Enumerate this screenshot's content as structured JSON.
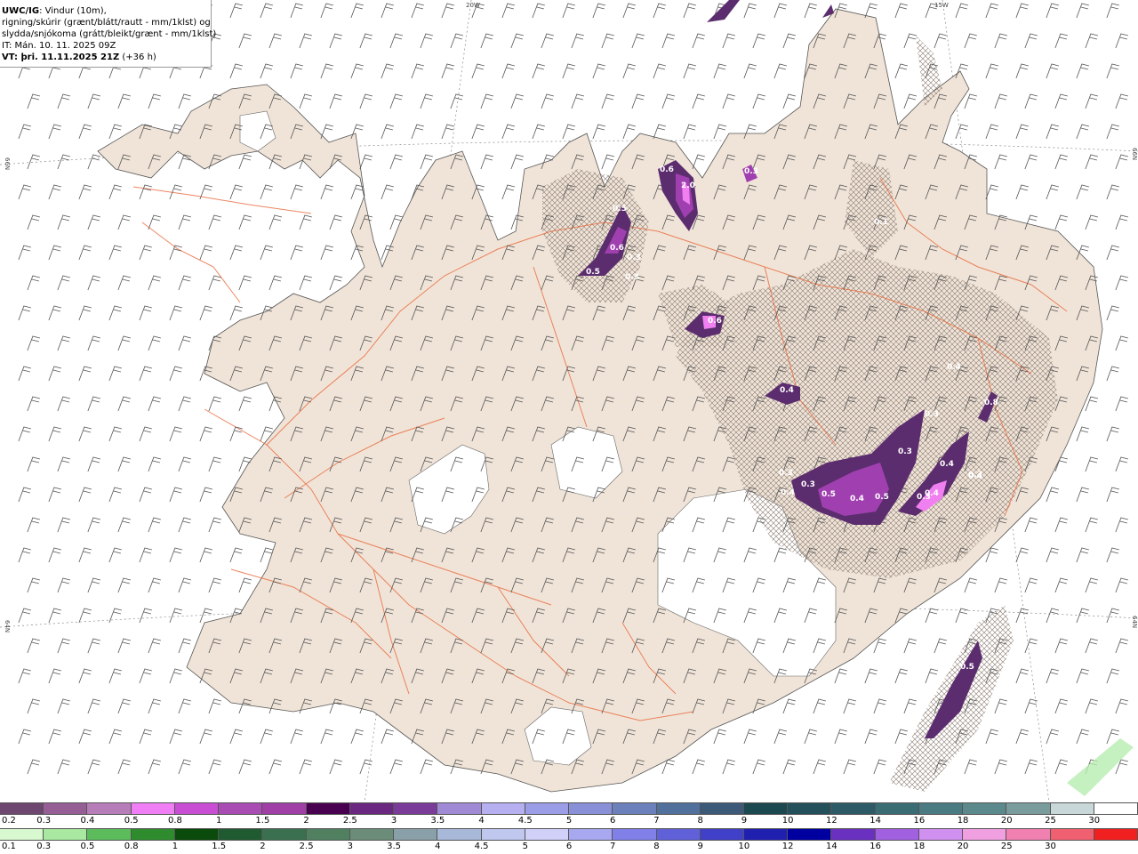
{
  "header": {
    "model_tag": "UWC/IG",
    "line1_rest": ": Vindur (10m),",
    "line2": "rigning/skúrir (grænt/blátt/rautt - mm/1klst) og",
    "line3": "slydda/snjókoma (grátt/bleikt/grænt - mm/1klst)",
    "line4": "IT: Mán. 10. 11. 2025 09Z",
    "line5_bold": "VT: þri. 11.11.2025 21Z",
    "line5_rest": " (+36 h)"
  },
  "map": {
    "coord_labels": {
      "top_20w": "20W",
      "top_15w": "15W",
      "left_66n": "66N",
      "left_64n": "64N",
      "right_66n": "66N",
      "right_64n": "64N"
    },
    "value_labels": [
      "0.6",
      "2.0",
      "0.3",
      "0.1",
      "0.5",
      "0.6",
      "0.3",
      "0.3",
      "0.5",
      "0.6",
      "0.4",
      "0.4",
      "0.3",
      "0.8",
      "0.3",
      "0.4",
      "0.4",
      "0.3",
      "0.4",
      "0.3",
      "0.5",
      "0.4",
      "0.5",
      "0.3",
      "0.4",
      "0.3",
      "0.5"
    ],
    "colors": {
      "land": "#f0e4d8",
      "roads": "#e8693a",
      "ice": "#ffffff",
      "sea": "#ffffff",
      "precip_light": "#5c2d6e",
      "precip_mid": "#a040b0",
      "precip_high": "#f080f0"
    }
  },
  "legend": {
    "snow_colors": [
      "#6d4770",
      "#955f96",
      "#b77db8",
      "#f07ff5",
      "#c84fd4",
      "#a94cb4",
      "#a03fa6",
      "#4a0050",
      "#6a2880",
      "#7a3c98",
      "#a08ad6",
      "#b6b0f0",
      "#9b9ee6",
      "#8a90d8",
      "#6c80bc",
      "#52709c",
      "#3c5a78",
      "#1c4850",
      "#24505c",
      "#2c5a66",
      "#3a6c74",
      "#4a7a82",
      "#5c8a8c",
      "#7a9c9c",
      "#c8d8d8",
      "#ffffff"
    ],
    "snow_labels": [
      "0.2",
      "0.3",
      "0.4",
      "0.5",
      "0.8",
      "1",
      "1.5",
      "2",
      "2.5",
      "3",
      "3.5",
      "4",
      "4.5",
      "5",
      "6",
      "7",
      "8",
      "9",
      "10",
      "12",
      "14",
      "16",
      "18",
      "20",
      "25",
      "30"
    ],
    "rain_colors": [
      "#d8f8d0",
      "#a8e8a0",
      "#5cbc5c",
      "#2e8c2e",
      "#0a4a0a",
      "#205a30",
      "#3a7050",
      "#508060",
      "#6a8c78",
      "#8aa0a8",
      "#a8b8d8",
      "#c0c8f0",
      "#d0d0f8",
      "#a8a8f0",
      "#8080e8",
      "#6060d8",
      "#4040c8",
      "#2020b0",
      "#0000a0",
      "#6a30c0",
      "#a060e0",
      "#d090f0",
      "#f0a0e0",
      "#f080b0",
      "#f06070",
      "#f02020"
    ],
    "rain_labels": [
      "0.1",
      "0.3",
      "0.5",
      "0.8",
      "1",
      "1.5",
      "2",
      "2.5",
      "3",
      "3.5",
      "4",
      "4.5",
      "5",
      "6",
      "7",
      "8",
      "9",
      "10",
      "12",
      "14",
      "16",
      "18",
      "20",
      "25",
      "30"
    ]
  }
}
